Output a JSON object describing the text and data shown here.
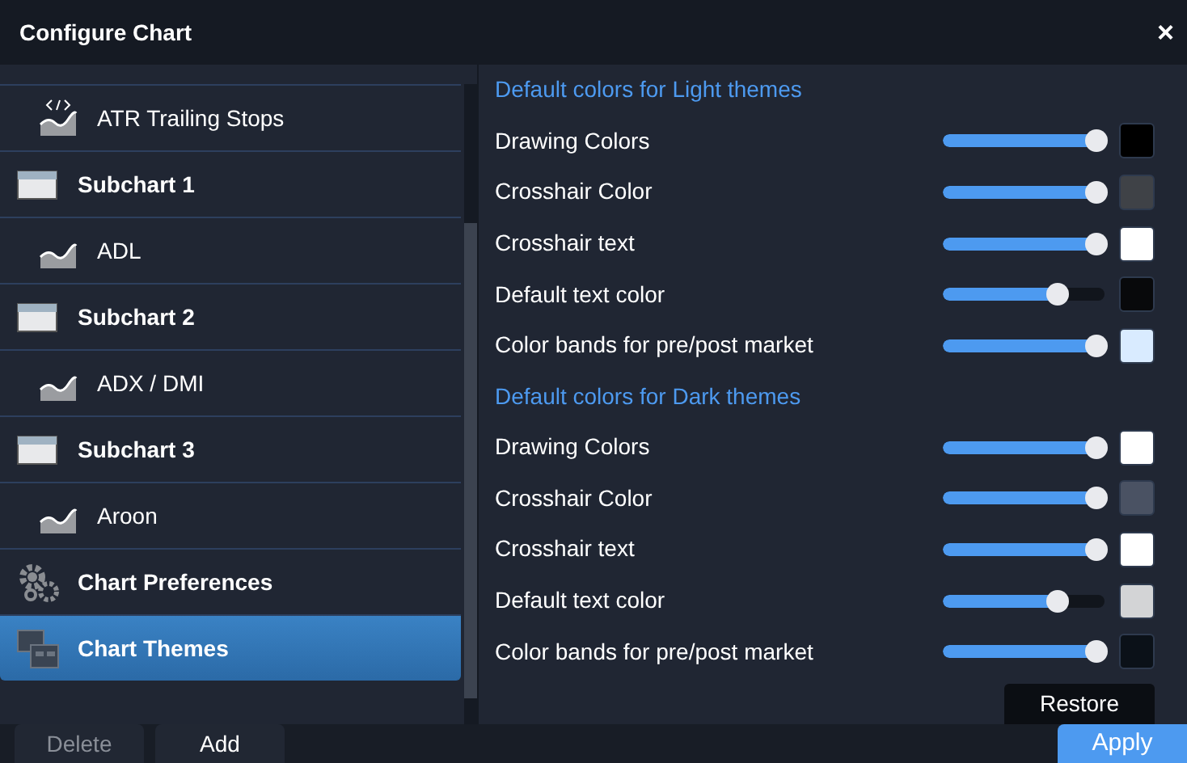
{
  "window": {
    "title": "Configure Chart",
    "close": "×"
  },
  "sidebar": {
    "items": [
      {
        "kind": "script-indicator",
        "label": "ATR Trailing Stops",
        "selected": false
      },
      {
        "kind": "subchart",
        "label": "Subchart 1",
        "selected": false,
        "children": [
          {
            "kind": "indicator",
            "label": "ADL",
            "selected": false
          }
        ]
      },
      {
        "kind": "subchart",
        "label": "Subchart 2",
        "selected": false,
        "children": [
          {
            "kind": "indicator",
            "label": "ADX / DMI",
            "selected": false
          }
        ]
      },
      {
        "kind": "subchart",
        "label": "Subchart 3",
        "selected": false,
        "children": [
          {
            "kind": "indicator",
            "label": "Aroon",
            "selected": false
          }
        ]
      },
      {
        "kind": "preferences",
        "label": "Chart Preferences",
        "selected": false
      },
      {
        "kind": "themes",
        "label": "Chart Themes",
        "selected": true
      }
    ]
  },
  "sections": [
    {
      "heading": "Default colors for Light themes",
      "rows": [
        {
          "label": "Drawing Colors",
          "level": 1,
          "color": "#000000"
        },
        {
          "label": "Crosshair Color",
          "level": 1,
          "color": "#3f4247"
        },
        {
          "label": "Crosshair text",
          "level": 1,
          "color": "#ffffff"
        },
        {
          "label": "Default text color",
          "level": 0.75,
          "color": "#08090b"
        },
        {
          "label": "Color bands for pre/post market",
          "level": 1,
          "color": "#d9ebff"
        }
      ]
    },
    {
      "heading": "Default colors for Dark themes",
      "rows": [
        {
          "label": "Drawing Colors",
          "level": 1,
          "color": "#ffffff"
        },
        {
          "label": "Crosshair Color",
          "level": 1,
          "color": "#4a5263"
        },
        {
          "label": "Crosshair text",
          "level": 1,
          "color": "#ffffff"
        },
        {
          "label": "Default text color",
          "level": 0.75,
          "color": "#d3d4d6"
        },
        {
          "label": "Color bands for pre/post market",
          "level": 1,
          "color": "#0b1118"
        }
      ]
    }
  ],
  "restore_button": "Restore",
  "footer": {
    "buttons": [
      {
        "label": "Delete",
        "disabled": true
      },
      {
        "label": "Add",
        "disabled": false
      }
    ],
    "apply": "Apply"
  }
}
